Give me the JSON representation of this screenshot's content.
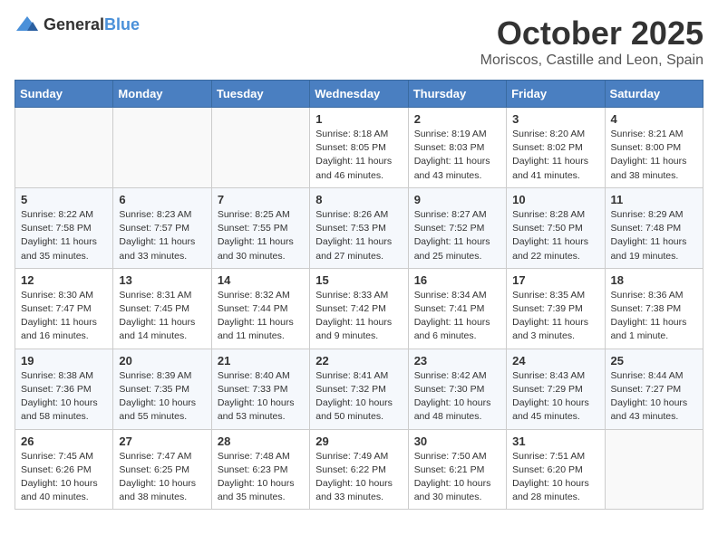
{
  "header": {
    "logo_general": "General",
    "logo_blue": "Blue",
    "month": "October 2025",
    "location": "Moriscos, Castille and Leon, Spain"
  },
  "weekdays": [
    "Sunday",
    "Monday",
    "Tuesday",
    "Wednesday",
    "Thursday",
    "Friday",
    "Saturday"
  ],
  "weeks": [
    [
      {
        "day": "",
        "info": ""
      },
      {
        "day": "",
        "info": ""
      },
      {
        "day": "",
        "info": ""
      },
      {
        "day": "1",
        "info": "Sunrise: 8:18 AM\nSunset: 8:05 PM\nDaylight: 11 hours\nand 46 minutes."
      },
      {
        "day": "2",
        "info": "Sunrise: 8:19 AM\nSunset: 8:03 PM\nDaylight: 11 hours\nand 43 minutes."
      },
      {
        "day": "3",
        "info": "Sunrise: 8:20 AM\nSunset: 8:02 PM\nDaylight: 11 hours\nand 41 minutes."
      },
      {
        "day": "4",
        "info": "Sunrise: 8:21 AM\nSunset: 8:00 PM\nDaylight: 11 hours\nand 38 minutes."
      }
    ],
    [
      {
        "day": "5",
        "info": "Sunrise: 8:22 AM\nSunset: 7:58 PM\nDaylight: 11 hours\nand 35 minutes."
      },
      {
        "day": "6",
        "info": "Sunrise: 8:23 AM\nSunset: 7:57 PM\nDaylight: 11 hours\nand 33 minutes."
      },
      {
        "day": "7",
        "info": "Sunrise: 8:25 AM\nSunset: 7:55 PM\nDaylight: 11 hours\nand 30 minutes."
      },
      {
        "day": "8",
        "info": "Sunrise: 8:26 AM\nSunset: 7:53 PM\nDaylight: 11 hours\nand 27 minutes."
      },
      {
        "day": "9",
        "info": "Sunrise: 8:27 AM\nSunset: 7:52 PM\nDaylight: 11 hours\nand 25 minutes."
      },
      {
        "day": "10",
        "info": "Sunrise: 8:28 AM\nSunset: 7:50 PM\nDaylight: 11 hours\nand 22 minutes."
      },
      {
        "day": "11",
        "info": "Sunrise: 8:29 AM\nSunset: 7:48 PM\nDaylight: 11 hours\nand 19 minutes."
      }
    ],
    [
      {
        "day": "12",
        "info": "Sunrise: 8:30 AM\nSunset: 7:47 PM\nDaylight: 11 hours\nand 16 minutes."
      },
      {
        "day": "13",
        "info": "Sunrise: 8:31 AM\nSunset: 7:45 PM\nDaylight: 11 hours\nand 14 minutes."
      },
      {
        "day": "14",
        "info": "Sunrise: 8:32 AM\nSunset: 7:44 PM\nDaylight: 11 hours\nand 11 minutes."
      },
      {
        "day": "15",
        "info": "Sunrise: 8:33 AM\nSunset: 7:42 PM\nDaylight: 11 hours\nand 9 minutes."
      },
      {
        "day": "16",
        "info": "Sunrise: 8:34 AM\nSunset: 7:41 PM\nDaylight: 11 hours\nand 6 minutes."
      },
      {
        "day": "17",
        "info": "Sunrise: 8:35 AM\nSunset: 7:39 PM\nDaylight: 11 hours\nand 3 minutes."
      },
      {
        "day": "18",
        "info": "Sunrise: 8:36 AM\nSunset: 7:38 PM\nDaylight: 11 hours\nand 1 minute."
      }
    ],
    [
      {
        "day": "19",
        "info": "Sunrise: 8:38 AM\nSunset: 7:36 PM\nDaylight: 10 hours\nand 58 minutes."
      },
      {
        "day": "20",
        "info": "Sunrise: 8:39 AM\nSunset: 7:35 PM\nDaylight: 10 hours\nand 55 minutes."
      },
      {
        "day": "21",
        "info": "Sunrise: 8:40 AM\nSunset: 7:33 PM\nDaylight: 10 hours\nand 53 minutes."
      },
      {
        "day": "22",
        "info": "Sunrise: 8:41 AM\nSunset: 7:32 PM\nDaylight: 10 hours\nand 50 minutes."
      },
      {
        "day": "23",
        "info": "Sunrise: 8:42 AM\nSunset: 7:30 PM\nDaylight: 10 hours\nand 48 minutes."
      },
      {
        "day": "24",
        "info": "Sunrise: 8:43 AM\nSunset: 7:29 PM\nDaylight: 10 hours\nand 45 minutes."
      },
      {
        "day": "25",
        "info": "Sunrise: 8:44 AM\nSunset: 7:27 PM\nDaylight: 10 hours\nand 43 minutes."
      }
    ],
    [
      {
        "day": "26",
        "info": "Sunrise: 7:45 AM\nSunset: 6:26 PM\nDaylight: 10 hours\nand 40 minutes."
      },
      {
        "day": "27",
        "info": "Sunrise: 7:47 AM\nSunset: 6:25 PM\nDaylight: 10 hours\nand 38 minutes."
      },
      {
        "day": "28",
        "info": "Sunrise: 7:48 AM\nSunset: 6:23 PM\nDaylight: 10 hours\nand 35 minutes."
      },
      {
        "day": "29",
        "info": "Sunrise: 7:49 AM\nSunset: 6:22 PM\nDaylight: 10 hours\nand 33 minutes."
      },
      {
        "day": "30",
        "info": "Sunrise: 7:50 AM\nSunset: 6:21 PM\nDaylight: 10 hours\nand 30 minutes."
      },
      {
        "day": "31",
        "info": "Sunrise: 7:51 AM\nSunset: 6:20 PM\nDaylight: 10 hours\nand 28 minutes."
      },
      {
        "day": "",
        "info": ""
      }
    ]
  ]
}
